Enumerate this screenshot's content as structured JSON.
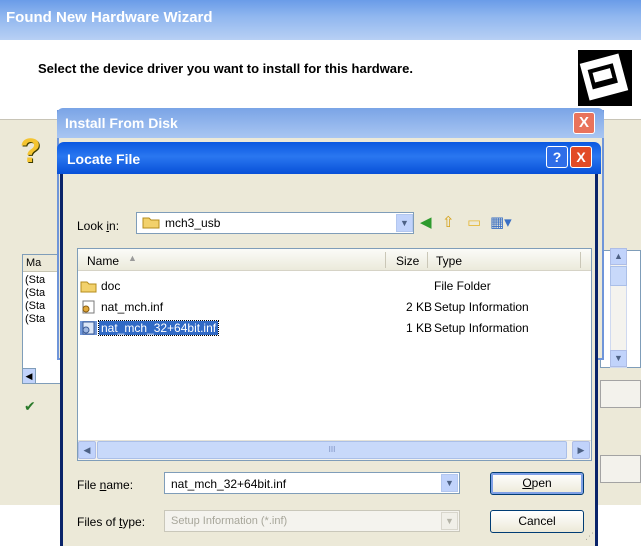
{
  "wizard": {
    "title": "Found New Hardware Wizard",
    "heading": "Select the device driver you want to install for this hardware.",
    "list_header": "Ma",
    "list_rows": [
      "(Sta",
      "(Sta",
      "(Sta",
      "(Sta"
    ]
  },
  "install_from_disk": {
    "title": "Install From Disk",
    "close_glyph": "X"
  },
  "locate_file": {
    "title": "Locate File",
    "help_glyph": "?",
    "close_glyph": "X",
    "look_in": {
      "label_pre": "Look ",
      "label_key": "i",
      "label_post": "n:",
      "value": "mch3_usb"
    },
    "columns": {
      "name": "Name",
      "size": "Size",
      "type": "Type"
    },
    "files": [
      {
        "name": "doc",
        "size": "",
        "type": "File Folder",
        "icon": "folder-icon",
        "selected": false
      },
      {
        "name": "nat_mch.inf",
        "size": "2 KB",
        "type": "Setup Information",
        "icon": "setup-file-icon",
        "selected": false
      },
      {
        "name": "nat_mch_32+64bit.inf",
        "size": "1 KB",
        "type": "Setup Information",
        "icon": "setup-file-icon",
        "selected": true
      }
    ],
    "file_name": {
      "label_pre": "File ",
      "label_key": "n",
      "label_post": "ame:",
      "value": "nat_mch_32+64bit.inf"
    },
    "files_of_type": {
      "label_pre": "Files of ",
      "label_key": "t",
      "label_post": "ype:",
      "value": "Setup Information (*.inf)"
    },
    "buttons": {
      "open_key": "O",
      "open_rest": "pen",
      "cancel": "Cancel"
    },
    "scroll_thumb_grip": "III"
  }
}
